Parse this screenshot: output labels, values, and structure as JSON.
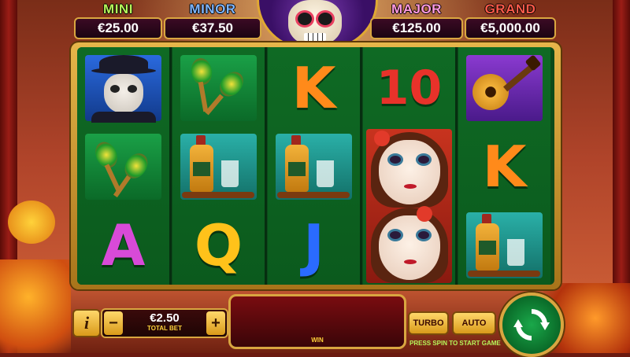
{
  "jackpots": {
    "mini": {
      "name": "MINI",
      "value": "€25.00"
    },
    "minor": {
      "name": "MINOR",
      "value": "€37.50"
    },
    "major": {
      "name": "MAJOR",
      "value": "€125.00"
    },
    "grand": {
      "name": "GRAND",
      "value": "€5,000.00"
    }
  },
  "reels": [
    [
      "man-skull-face",
      "maracas",
      "A"
    ],
    [
      "maracas",
      "tequila",
      "Q"
    ],
    [
      "K",
      "tequila",
      "J"
    ],
    [
      "10",
      "catrina-woman",
      "catrina-woman"
    ],
    [
      "guitar",
      "K",
      "tequila"
    ]
  ],
  "letters": {
    "r0c2": "K",
    "r0c3": "10",
    "r1c4": "K",
    "r2c0": "A",
    "r2c1": "Q",
    "r2c2": "J"
  },
  "colors": {
    "K": "#ff8a1a",
    "10": "#e8322a",
    "A": "#d84ad8",
    "Q": "#ffc21a",
    "J": "#2a6bff"
  },
  "controls": {
    "info_label": "i",
    "bet_minus": "−",
    "bet_plus": "+",
    "bet_value": "€2.50",
    "bet_label": "TOTAL BET",
    "win_label": "WIN",
    "turbo_label": "TURBO",
    "auto_label": "AUTO",
    "hint": "PRESS SPIN TO START GAME",
    "spin_icon": "refresh-arrows-icon"
  }
}
